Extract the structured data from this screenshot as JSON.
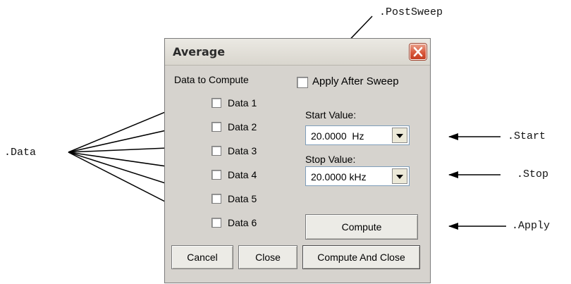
{
  "annotations": {
    "postsweep": ".PostSweep",
    "data": ".Data",
    "start": ".Start",
    "stop": ".Stop",
    "apply": ".Apply"
  },
  "dialog": {
    "title": "Average",
    "data_group_label": "Data to Compute",
    "apply_after_sweep_label": "Apply After Sweep",
    "data_items": [
      "Data 1",
      "Data 2",
      "Data 3",
      "Data 4",
      "Data 5",
      "Data 6"
    ],
    "start_label": "Start Value:",
    "start_value": "20.0000  Hz",
    "stop_label": "Stop Value:",
    "stop_value": "20.0000 kHz",
    "compute_label": "Compute",
    "cancel_label": "Cancel",
    "close_label": "Close",
    "compute_close_label": "Compute And Close"
  },
  "colors": {
    "dialog_bg": "#d6d3ce",
    "close_button": "#d9593d",
    "arrow": "#000000"
  }
}
